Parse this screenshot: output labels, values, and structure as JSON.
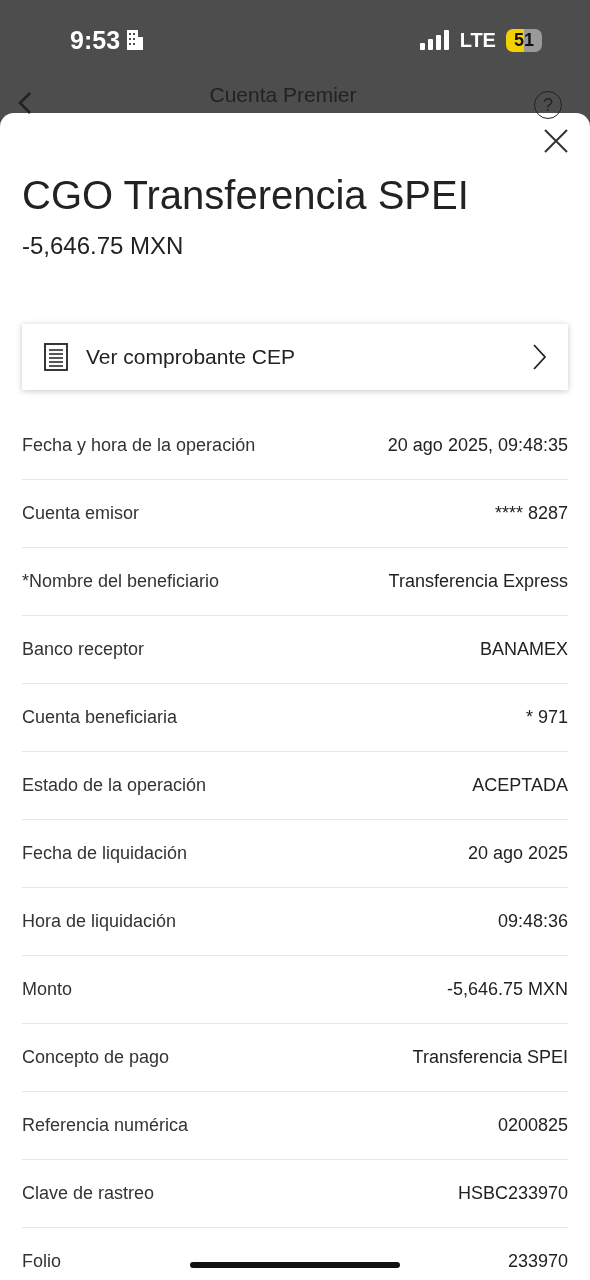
{
  "status_bar": {
    "time": "9:53",
    "network": "LTE",
    "battery": "51"
  },
  "nav": {
    "title": "Cuenta Premier",
    "help": "?"
  },
  "sheet": {
    "title": "CGO Transferencia SPEI",
    "amount": "-5,646.75 MXN",
    "receipt_link": "Ver comprobante CEP",
    "details": [
      {
        "label": "Fecha y hora de la operación",
        "value": "20 ago 2025, 09:48:35"
      },
      {
        "label": "Cuenta emisor",
        "value": "**** 8287"
      },
      {
        "label": "*Nombre del beneficiario",
        "value": "Transferencia Express"
      },
      {
        "label": "Banco receptor",
        "value": "BANAMEX"
      },
      {
        "label": "Cuenta beneficiaria",
        "value": "* 971"
      },
      {
        "label": "Estado de la operación",
        "value": "ACEPTADA"
      },
      {
        "label": "Fecha de liquidación",
        "value": "20 ago 2025"
      },
      {
        "label": "Hora de liquidación",
        "value": "09:48:36"
      },
      {
        "label": "Monto",
        "value": "-5,646.75 MXN"
      },
      {
        "label": "Concepto de pago",
        "value": "Transferencia SPEI"
      },
      {
        "label": "Referencia numérica",
        "value": "0200825"
      },
      {
        "label": "Clave de rastreo",
        "value": "HSBC233970"
      },
      {
        "label": "Folio",
        "value": "233970"
      }
    ]
  }
}
